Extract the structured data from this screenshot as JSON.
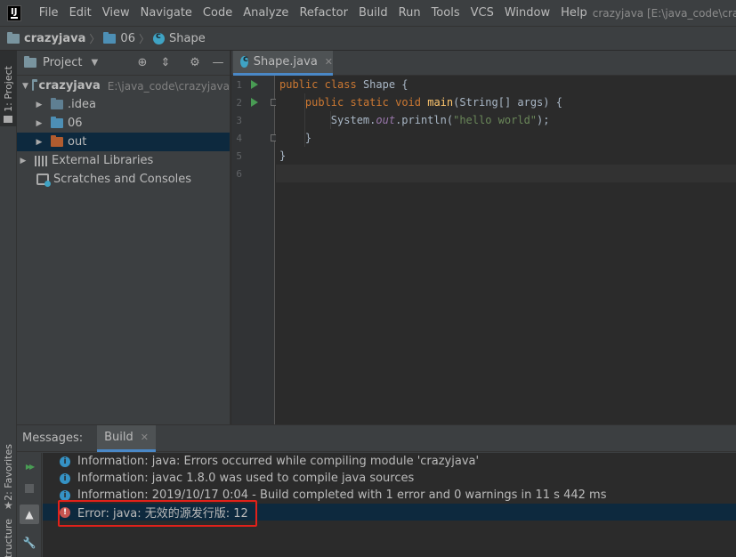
{
  "menubar": {
    "items": [
      "File",
      "Edit",
      "View",
      "Navigate",
      "Code",
      "Analyze",
      "Refactor",
      "Build",
      "Run",
      "Tools",
      "VCS",
      "Window",
      "Help"
    ],
    "window_title": "crazyjava [E:\\java_code\\crazyjava]"
  },
  "breadcrumb": {
    "project": "crazyjava",
    "folder": "06",
    "file": "Shape"
  },
  "left_strip": {
    "project_tab": "1: Project",
    "favorites_tab": "2: Favorites",
    "structure_tab": "Structure"
  },
  "project_panel": {
    "title": "Project",
    "tree": [
      {
        "label": "crazyjava",
        "path": "E:\\java_code\\crazyjava"
      },
      {
        "label": ".idea"
      },
      {
        "label": "06"
      },
      {
        "label": "out"
      },
      {
        "label": "External Libraries"
      },
      {
        "label": "Scratches and Consoles"
      }
    ]
  },
  "editor": {
    "tab_label": "Shape.java",
    "line_numbers": [
      "1",
      "2",
      "3",
      "4",
      "5",
      "6"
    ],
    "code": {
      "l1_kw1": "public",
      "l1_kw2": "class",
      "l1_name": "Shape {",
      "l2_kw1": "public",
      "l2_kw2": "static",
      "l2_kw3": "void",
      "l2_fn": "main",
      "l2_rest": "(String[] args) {",
      "l3_obj": "System.",
      "l3_field": "out",
      "l3_call": ".println(",
      "l3_str": "\"hello world\"",
      "l3_end": ");",
      "l4": "}",
      "l5": "}"
    }
  },
  "messages": {
    "title": "Messages:",
    "build_tab": "Build",
    "rows": [
      {
        "type": "info",
        "text": "Information: java: Errors occurred while compiling module 'crazyjava'"
      },
      {
        "type": "info",
        "text": "Information: javac 1.8.0 was used to compile java sources"
      },
      {
        "type": "info",
        "text": "Information: 2019/10/17 0:04 - Build completed with 1 error and 0 warnings in 11 s 442 ms"
      },
      {
        "type": "error",
        "text": "Error: java: 无效的源发行版: 12"
      }
    ]
  },
  "colors": {
    "accent": "#4a88c7",
    "error_highlight": "#e0211a",
    "selection": "#0d293e"
  }
}
